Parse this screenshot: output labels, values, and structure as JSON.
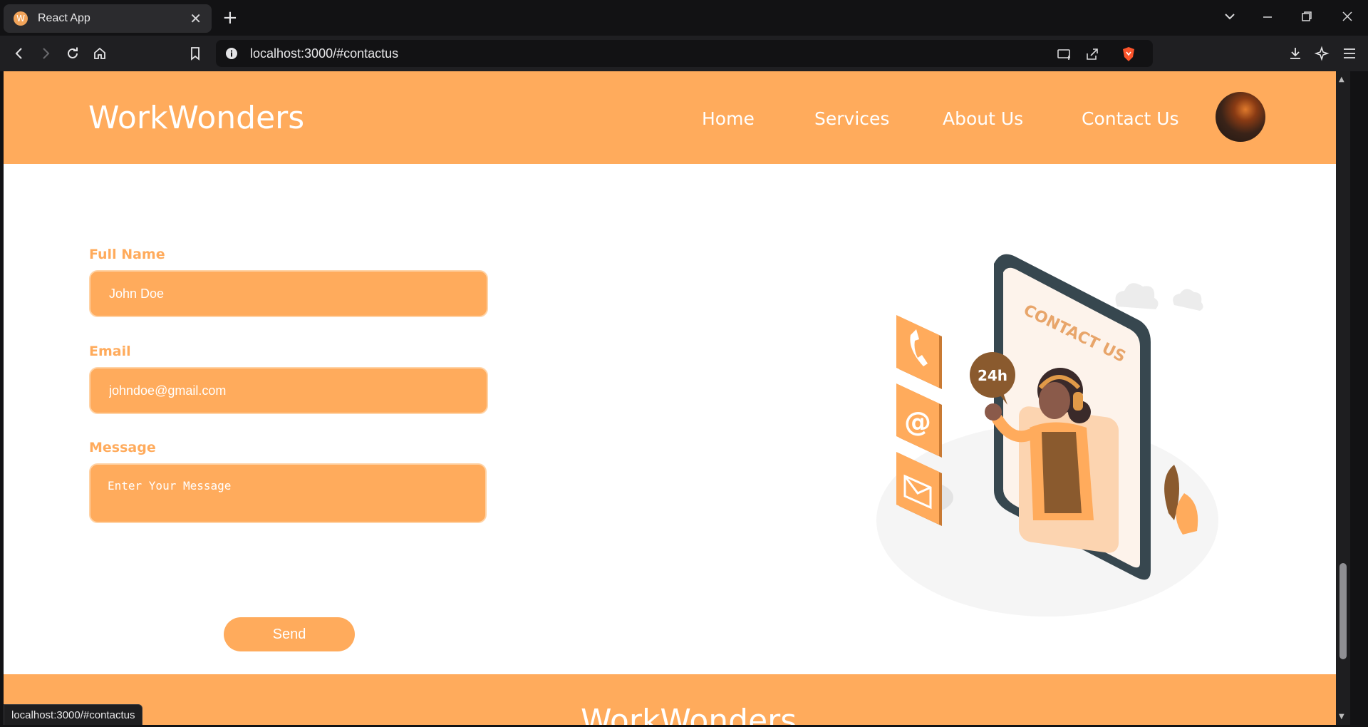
{
  "browser": {
    "tab_title": "React App",
    "tab_favicon_letter": "W",
    "new_tab_symbol": "+",
    "close_symbol": "✕",
    "url": "localhost:3000/#contactus",
    "status_url": "localhost:3000/#contactus"
  },
  "site": {
    "brand": "WorkWonders",
    "nav": [
      {
        "label": "Home"
      },
      {
        "label": "Services"
      },
      {
        "label": "About Us"
      },
      {
        "label": "Contact Us"
      }
    ],
    "footer_brand": "WorkWonders"
  },
  "form": {
    "name_label": "Full Name",
    "name_value": "John Doe",
    "email_label": "Email",
    "email_value": "johndoe@gmail.com",
    "message_label": "Message",
    "message_placeholder": "Enter Your Message",
    "send_label": "Send"
  },
  "illustration": {
    "screen_text": "CONTACT US",
    "bubble_text": "24h",
    "icons": [
      "phone-icon",
      "at-sign-icon",
      "envelope-icon"
    ]
  },
  "colors": {
    "brand_orange": "#ffab5c",
    "white": "#ffffff",
    "chrome_dark": "#121214"
  }
}
